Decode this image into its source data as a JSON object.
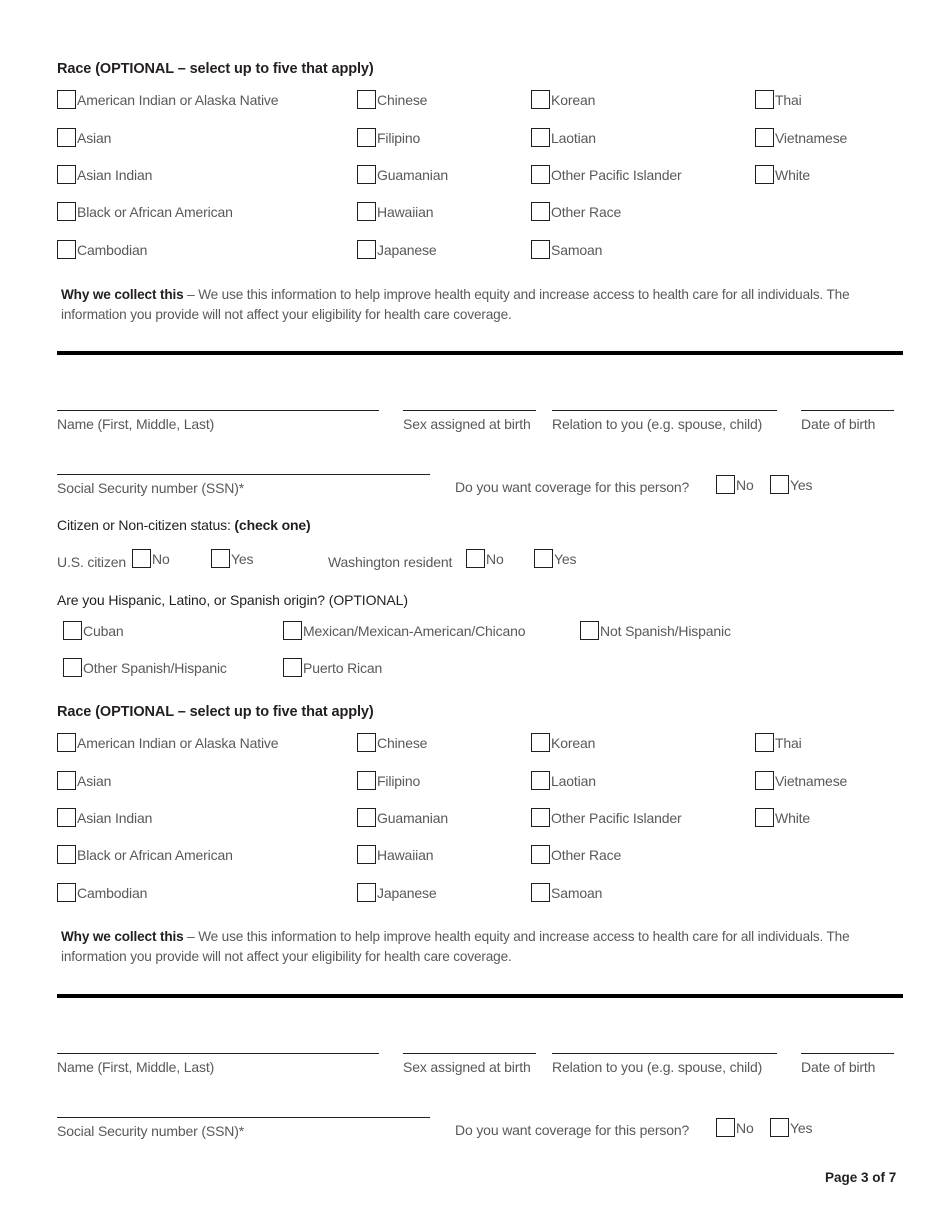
{
  "document": {
    "page_footer": "Page 3 of 7"
  },
  "race_section": {
    "heading": "Race (OPTIONAL – select up to five that apply)",
    "columns": [
      [
        "American Indian or Alaska Native",
        "Asian",
        "Asian Indian",
        "Black or African American",
        "Cambodian"
      ],
      [
        "Chinese",
        "Filipino",
        "Guamanian",
        "Hawaiian",
        "Japanese"
      ],
      [
        "Korean",
        "Laotian",
        "Other Pacific Islander",
        "Other Race",
        "Samoan"
      ],
      [
        "Thai",
        "Vietnamese",
        "White"
      ]
    ],
    "why_bold": "Why we collect this",
    "why_text": " – We use this information to help improve health equity and increase access to health care for all individuals. The information you provide will not affect your eligibility for health care coverage."
  },
  "person_fields": {
    "name": "Name (First, Middle, Last)",
    "sex": "Sex assigned at birth",
    "relation": "Relation to you (e.g. spouse, child)",
    "dob": "Date of birth",
    "ssn": "Social Security number (SSN)*",
    "coverage_question": "Do you want coverage for this person?",
    "no": "No",
    "yes": "Yes"
  },
  "citizen_section": {
    "label_plain": "Citizen or Non-citizen status: ",
    "label_bold": "(check one)",
    "us_citizen": "U.S. citizen",
    "wa_resident": "Washington resident",
    "no": "No",
    "yes": "Yes"
  },
  "hispanic_section": {
    "heading": "Are you Hispanic, Latino, or Spanish origin? (OPTIONAL)",
    "columns": [
      [
        "Cuban",
        "Other Spanish/Hispanic"
      ],
      [
        "Mexican/Mexican-American/Chicano",
        "Puerto Rican"
      ],
      [
        "Not Spanish/Hispanic"
      ]
    ]
  }
}
